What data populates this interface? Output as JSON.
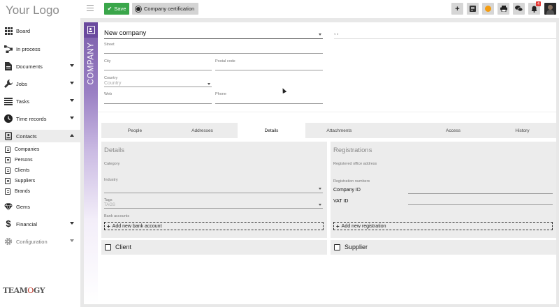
{
  "app": {
    "logo_text": "Your Logo",
    "brand_prefix": "TEAM",
    "brand_mark": "O",
    "brand_suffix": "GY"
  },
  "sidebar": {
    "items": [
      {
        "label": "Board",
        "icon": "grid-icon"
      },
      {
        "label": "In process",
        "icon": "workflow-icon"
      },
      {
        "label": "Documents",
        "icon": "document-icon",
        "expandable": true
      },
      {
        "label": "Jobs",
        "icon": "wrench-icon",
        "expandable": true
      },
      {
        "label": "Tasks",
        "icon": "list-icon",
        "expandable": true
      },
      {
        "label": "Time records",
        "icon": "clock-icon",
        "expandable": true
      },
      {
        "label": "Contacts",
        "icon": "contact-card-icon",
        "expandable": true,
        "expanded": true
      },
      {
        "label": "Gems",
        "icon": "diamond-icon"
      },
      {
        "label": "Financial",
        "icon": "dollar-icon",
        "expandable": true
      },
      {
        "label": "Configuration",
        "icon": "gear-icon",
        "expandable": true,
        "disabled": true
      }
    ],
    "contacts_children": [
      "Companies",
      "Persons",
      "Clients",
      "Suppliers",
      "Brands"
    ]
  },
  "toolbar": {
    "save_label": "Save",
    "certification_label": "Company certification",
    "notification_count": "4"
  },
  "form": {
    "section_label": "COMPANY",
    "company_type": "New company",
    "name_value": ", ,",
    "street_label": "Street",
    "city_label": "City",
    "postal_code_label": "Postal code",
    "country_label": "Country",
    "country_placeholder": "Country",
    "web_label": "Web",
    "phone_label": "Phone"
  },
  "tabs": [
    {
      "label": "People"
    },
    {
      "label": "Addresses"
    },
    {
      "label": "Details",
      "active": true
    },
    {
      "label": "Attachments"
    },
    {
      "label": ""
    },
    {
      "label": "Access"
    },
    {
      "label": "History"
    }
  ],
  "details": {
    "title": "Details",
    "category_label": "Category",
    "industry_label": "Industry",
    "tags_label": "Tags",
    "tags_placeholder": "TAGS",
    "bank_accounts_label": "Bank accounts",
    "add_bank_account": "Add new bank account"
  },
  "registrations": {
    "title": "Registrations",
    "registered_office_label": "Registered office address",
    "registration_numbers_label": "Registration numbers",
    "company_id_label": "Company ID",
    "vat_id_label": "VAT ID",
    "add_registration": "Add new registration"
  },
  "roles": {
    "client_label": "Client",
    "supplier_label": "Supplier"
  },
  "colors": {
    "accent_purple": "#6a4a9e",
    "save_green": "#3aa64a",
    "notification_red": "#e53935",
    "status_orange": "#f39c12"
  }
}
